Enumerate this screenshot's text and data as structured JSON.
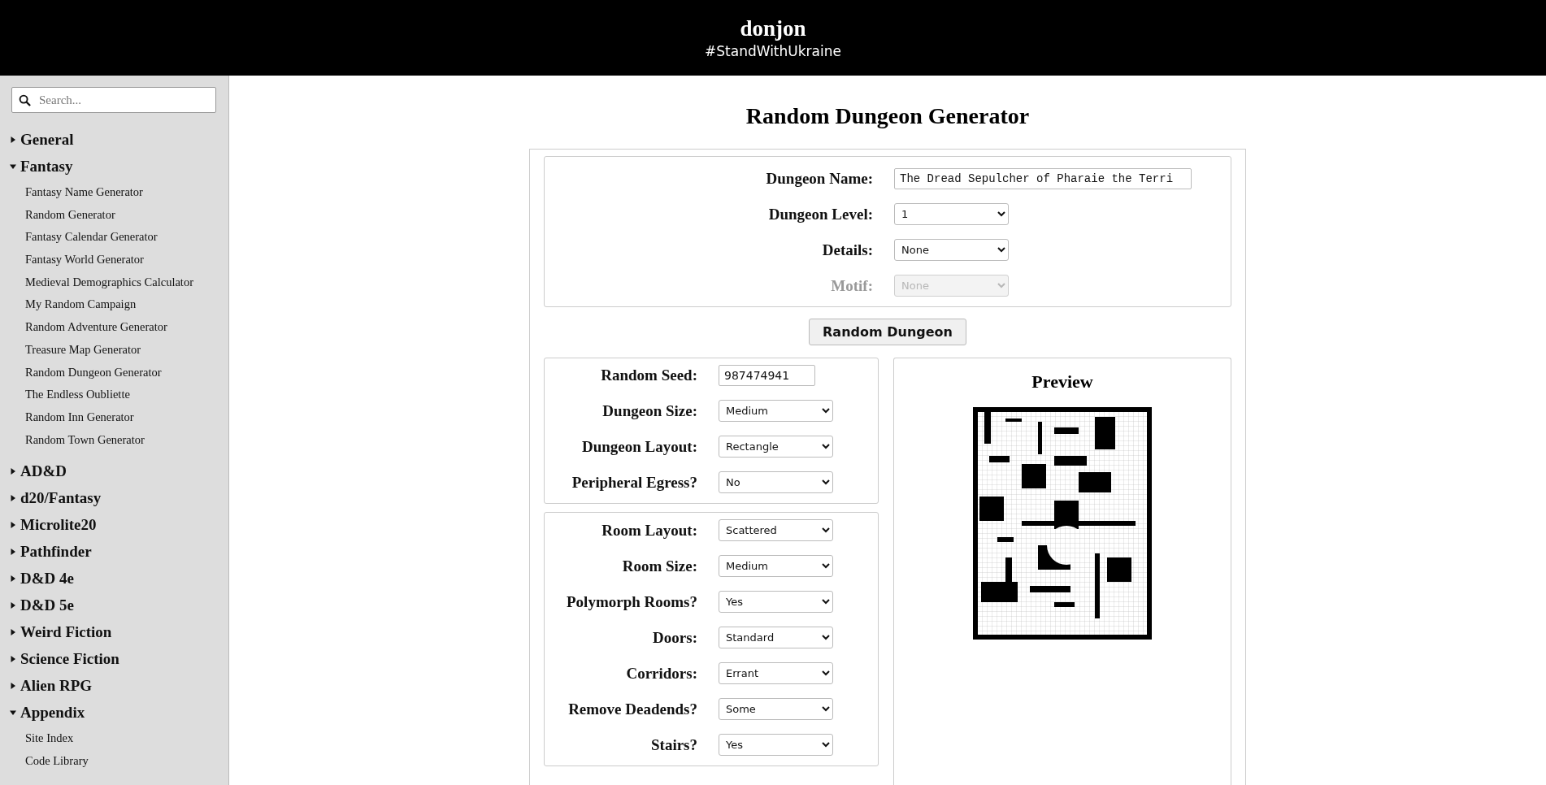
{
  "header": {
    "title": "donjon",
    "subtitle": "#StandWithUkraine"
  },
  "sidebar": {
    "search": {
      "placeholder": "Search..."
    },
    "sections": [
      {
        "label": "General",
        "expanded": false
      },
      {
        "label": "Fantasy",
        "expanded": true,
        "children": [
          {
            "label": "Fantasy Name Generator"
          },
          {
            "label": "Random Generator"
          },
          {
            "label": "Fantasy Calendar Generator"
          },
          {
            "label": "Fantasy World Generator"
          },
          {
            "label": "Medieval Demographics Calculator"
          },
          {
            "label": "My Random Campaign"
          },
          {
            "label": "Random Adventure Generator"
          },
          {
            "label": "Treasure Map Generator"
          },
          {
            "label": "Random Dungeon Generator"
          },
          {
            "label": "The Endless Oubliette"
          },
          {
            "label": "Random Inn Generator"
          },
          {
            "label": "Random Town Generator"
          }
        ]
      },
      {
        "label": "AD&D",
        "expanded": false
      },
      {
        "label": "d20/Fantasy",
        "expanded": false
      },
      {
        "label": "Microlite20",
        "expanded": false
      },
      {
        "label": "Pathfinder",
        "expanded": false
      },
      {
        "label": "D&D 4e",
        "expanded": false
      },
      {
        "label": "D&D 5e",
        "expanded": false
      },
      {
        "label": "Weird Fiction",
        "expanded": false
      },
      {
        "label": "Science Fiction",
        "expanded": false
      },
      {
        "label": "Alien RPG",
        "expanded": false
      },
      {
        "label": "Appendix",
        "expanded": true,
        "children": [
          {
            "label": "Site Index"
          },
          {
            "label": "Code Library"
          }
        ]
      }
    ]
  },
  "page": {
    "title": "Random Dungeon Generator"
  },
  "basic_fields": [
    {
      "label": "Dungeon Name:",
      "kind": "text",
      "value": "The Dread Sepulcher of Pharaie the Terri"
    },
    {
      "label": "Dungeon Level:",
      "kind": "select",
      "value": "1",
      "disabled": false
    },
    {
      "label": "Details:",
      "kind": "select",
      "value": "None",
      "disabled": false
    },
    {
      "label": "Motif:",
      "kind": "select",
      "value": "None",
      "disabled": true
    }
  ],
  "generate_button": "Random Dungeon",
  "option_groups": [
    {
      "fields": [
        {
          "label": "Random Seed:",
          "kind": "text",
          "value": "987474941"
        },
        {
          "label": "Dungeon Size:",
          "kind": "select",
          "value": "Medium",
          "disabled": false
        },
        {
          "label": "Dungeon Layout:",
          "kind": "select",
          "value": "Rectangle",
          "disabled": false
        },
        {
          "label": "Peripheral Egress?",
          "kind": "select",
          "value": "No",
          "disabled": false
        }
      ]
    },
    {
      "fields": [
        {
          "label": "Room Layout:",
          "kind": "select",
          "value": "Scattered",
          "disabled": false
        },
        {
          "label": "Room Size:",
          "kind": "select",
          "value": "Medium",
          "disabled": false
        },
        {
          "label": "Polymorph Rooms?",
          "kind": "select",
          "value": "Yes",
          "disabled": false
        },
        {
          "label": "Doors:",
          "kind": "select",
          "value": "Standard",
          "disabled": false
        },
        {
          "label": "Corridors:",
          "kind": "select",
          "value": "Errant",
          "disabled": false
        },
        {
          "label": "Remove Deadends?",
          "kind": "select",
          "value": "Some",
          "disabled": false
        },
        {
          "label": "Stairs?",
          "kind": "select",
          "value": "Yes",
          "disabled": false
        }
      ]
    }
  ],
  "preview": {
    "title": "Preview"
  }
}
